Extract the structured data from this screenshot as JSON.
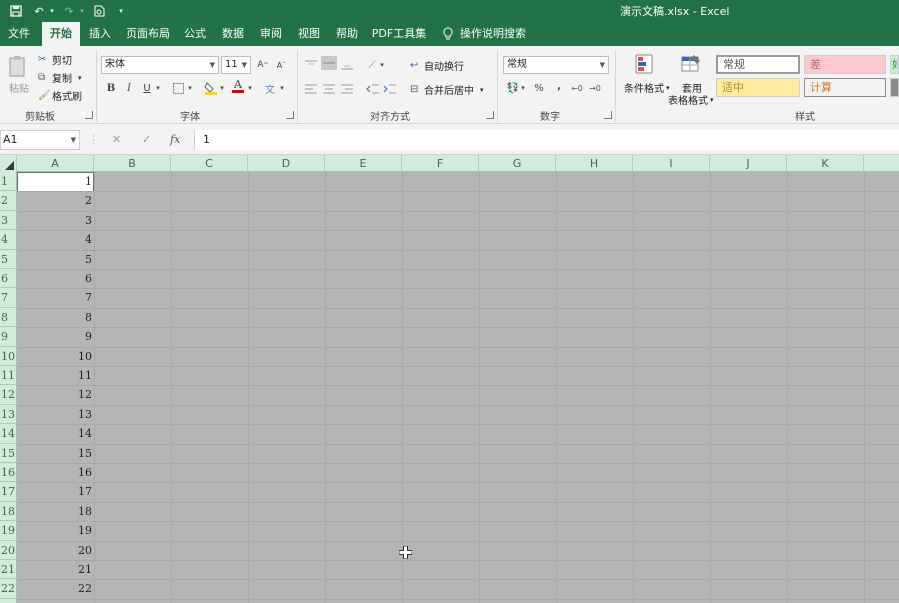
{
  "window": {
    "document_title": "演示文稿.xlsx",
    "app_name": "Excel",
    "separator": " - "
  },
  "tabs": [
    "文件",
    "开始",
    "插入",
    "页面布局",
    "公式",
    "数据",
    "审阅",
    "视图",
    "帮助",
    "PDF工具集",
    "操作说明搜索"
  ],
  "active_tab": "开始",
  "ribbon": {
    "clipboard": {
      "paste": "粘贴",
      "cut": "剪切",
      "copy": "复制",
      "format_painter": "格式刷",
      "group": "剪贴板"
    },
    "font": {
      "name": "宋体",
      "size": "11",
      "bold": "B",
      "italic": "I",
      "underline": "U",
      "font_color_glyph": "A",
      "wen_glyph": "文",
      "grow": "A",
      "shrink": "A",
      "group": "字体"
    },
    "alignment": {
      "wrap": "自动换行",
      "merge": "合并后居中",
      "group": "对齐方式"
    },
    "number": {
      "format": "常规",
      "percent": "%",
      "comma": ",",
      "group": "数字"
    },
    "styles": {
      "conditional": "条件格式",
      "table_format_line1": "套用",
      "table_format_line2": "表格格式",
      "normal": "常规",
      "bad": "差",
      "good_partial": "好",
      "neutral": "适中",
      "calculation": "计算",
      "group": "样式"
    }
  },
  "formula_bar": {
    "name_box": "A1",
    "content": "1",
    "cancel": "✕",
    "enter": "✓",
    "fx": "fx"
  },
  "columns": [
    "A",
    "B",
    "C",
    "D",
    "E",
    "F",
    "G",
    "H",
    "I",
    "J",
    "K"
  ],
  "rows": [
    "1",
    "2",
    "3",
    "4",
    "5",
    "6",
    "7",
    "8",
    "9",
    "10",
    "11",
    "12",
    "13",
    "14",
    "15",
    "16",
    "17",
    "18",
    "19",
    "20",
    "21",
    "22"
  ],
  "column_a_values": [
    "1",
    "2",
    "3",
    "4",
    "5",
    "6",
    "7",
    "8",
    "9",
    "10",
    "11",
    "12",
    "13",
    "14",
    "15",
    "16",
    "17",
    "18",
    "19",
    "20",
    "21",
    "22"
  ],
  "colors": {
    "brand": "#217346",
    "header_green": "#d2ecdc",
    "selection_gray": "#b5b5b5",
    "bad_fill": "#ffc7ce",
    "neutral_fill": "#ffeb9c",
    "good_fill": "#c6efce"
  }
}
